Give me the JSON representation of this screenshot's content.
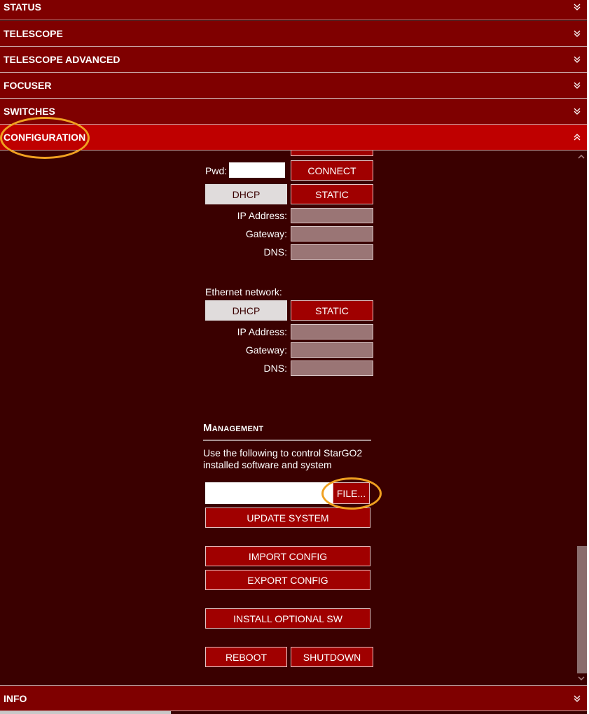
{
  "accordion": {
    "status": "STATUS",
    "telescope": "TELESCOPE",
    "telescope_advanced": "TELESCOPE ADVANCED",
    "focuser": "FOCUSER",
    "switches": "SWITCHES",
    "configuration": "CONFIGURATION",
    "info": "INFO"
  },
  "wifi": {
    "pwd_label": "Pwd:",
    "connect": "CONNECT",
    "dhcp": "DHCP",
    "static": "STATIC",
    "ip_label": "IP Address:",
    "gateway_label": "Gateway:",
    "dns_label": "DNS:"
  },
  "ethernet": {
    "title": "Ethernet network:",
    "dhcp": "DHCP",
    "static": "STATIC",
    "ip_label": "IP Address:",
    "gateway_label": "Gateway:",
    "dns_label": "DNS:"
  },
  "management": {
    "title": "Management",
    "description": "Use the following to control StarGO2 installed software and system",
    "file_button": "FILE...",
    "update_system": "UPDATE SYSTEM",
    "import_config": "IMPORT CONFIG",
    "export_config": "EXPORT CONFIG",
    "install_optional": "INSTALL OPTIONAL SW",
    "reboot": "REBOOT",
    "shutdown": "SHUTDOWN"
  },
  "colors": {
    "header": "#7f0000",
    "header_active": "#bf0000",
    "background": "#3a0000",
    "button": "#a00000",
    "highlight": "#f0a020"
  }
}
